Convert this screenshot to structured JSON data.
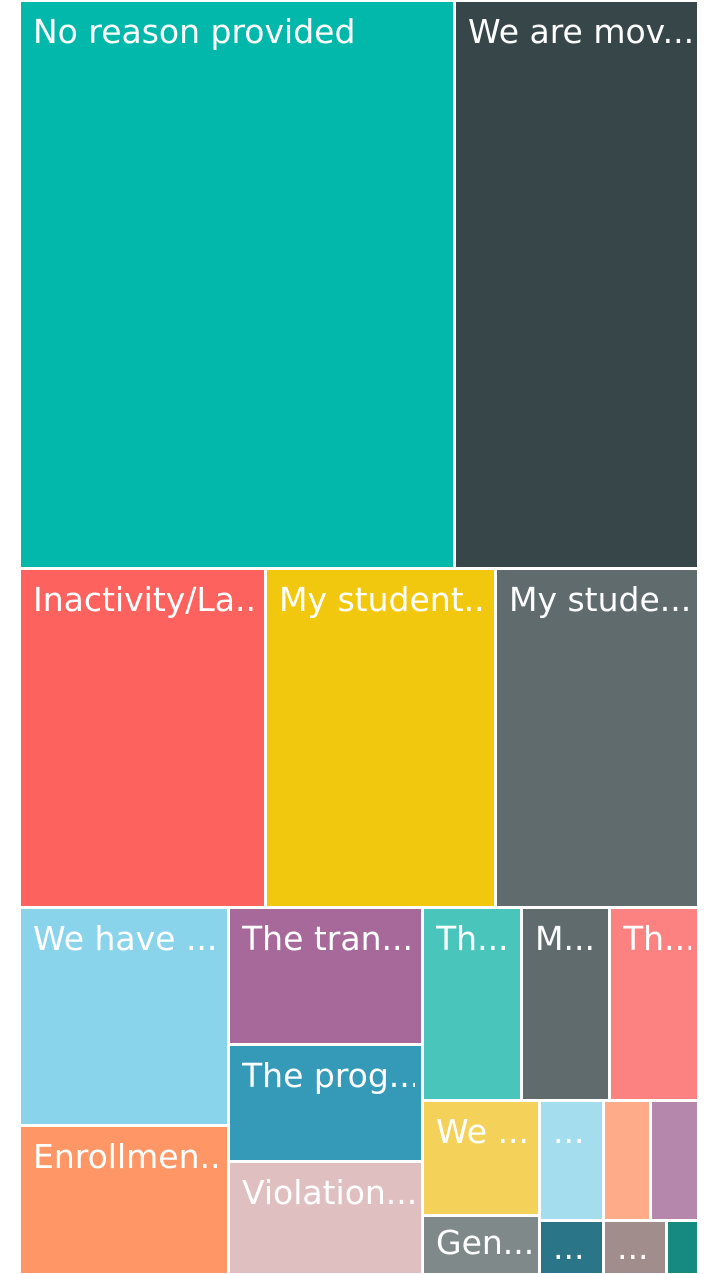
{
  "chart_data": {
    "type": "treemap",
    "items": [
      {
        "label": "No reason provided",
        "value": 243,
        "color": "#01B8AA"
      },
      {
        "label": "We are mov...",
        "value": 134,
        "color": "#374649"
      },
      {
        "label": "Inactivity/La...",
        "value": 74,
        "color": "#FD625E"
      },
      {
        "label": "My student...",
        "value": 69,
        "color": "#F2C80F"
      },
      {
        "label": "My stude...",
        "value": 61,
        "color": "#5F6B6D"
      },
      {
        "label": "We have ...",
        "value": 39,
        "color": "#8AD4EB"
      },
      {
        "label": "Enrollmen...",
        "value": 24,
        "color": "#FE9666"
      },
      {
        "label": "The tran...",
        "value": 19,
        "color": "#A66999"
      },
      {
        "label": "The prog...",
        "value": 19,
        "color": "#3599B8"
      },
      {
        "label": "Violation...",
        "value": 18,
        "color": "#DFBFBF"
      },
      {
        "label": "Th...",
        "value": 17,
        "color": "#4AC5BB"
      },
      {
        "label": "M...",
        "value": 17,
        "color": "#5F6B6D"
      },
      {
        "label": "Th...",
        "value": 17,
        "color": "#FB8281"
      },
      {
        "label": "We ...",
        "value": 9,
        "color": "#F4D25A"
      },
      {
        "label": "Gen...",
        "value": 4,
        "color": "#7F898A"
      },
      {
        "label": "...",
        "value": 8,
        "color": "#A4DDEE"
      },
      {
        "label": "...",
        "value": 3,
        "color": "#2B7589"
      },
      {
        "label": "",
        "value": 6,
        "color": "#FDAB89"
      },
      {
        "label": "...",
        "value": 2,
        "color": "#A28D8D"
      },
      {
        "label": "",
        "value": 6,
        "color": "#B687AC"
      },
      {
        "label": "",
        "value": 2,
        "color": "#168980"
      }
    ]
  }
}
